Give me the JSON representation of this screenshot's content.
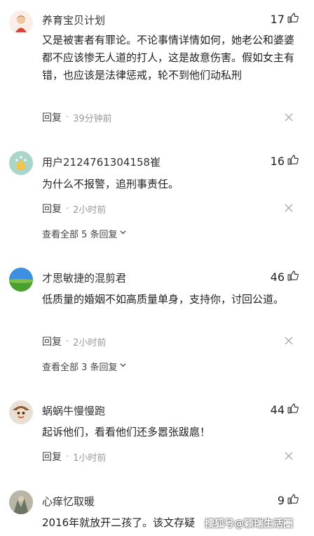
{
  "comments": [
    {
      "username": "养育宝贝计划",
      "likes": "17",
      "text": "又是被害者有罪论。不论事情详情如何，她老公和婆婆都不应该惨无人道的打人，这是故意伤害。假如女主有错，也应该是法律惩戒，轮不到他们动私刑",
      "reply_label": "回复",
      "time": "39分钟前"
    },
    {
      "username": "用户2124761304158崔",
      "likes": "16",
      "text": "为什么不报警，追刑事责任。",
      "reply_label": "回复",
      "time": "2小时前",
      "view_all": "查看全部 5 条回复"
    },
    {
      "username": "才思敏捷的混剪君",
      "likes": "46",
      "text": "低质量的婚姻不如高质量单身，支持你，讨回公道。",
      "reply_label": "回复",
      "time": "2小时前",
      "view_all": "查看全部 3 条回复"
    },
    {
      "username": "蜗蜗牛慢慢跑",
      "likes": "44",
      "text": "起诉他们，看看他们还多嚣张跋扈！",
      "reply_label": "回复",
      "time": "1小时前"
    },
    {
      "username": "心痒忆取暖",
      "likes": "9",
      "text": "2016年就放开二孩了。该文存疑"
    }
  ],
  "watermark": "搜狐号@颖瑞生活圈",
  "icons": {
    "like": "thumbs-up-icon",
    "close": "close-icon",
    "expand": "chevron-down-icon"
  }
}
